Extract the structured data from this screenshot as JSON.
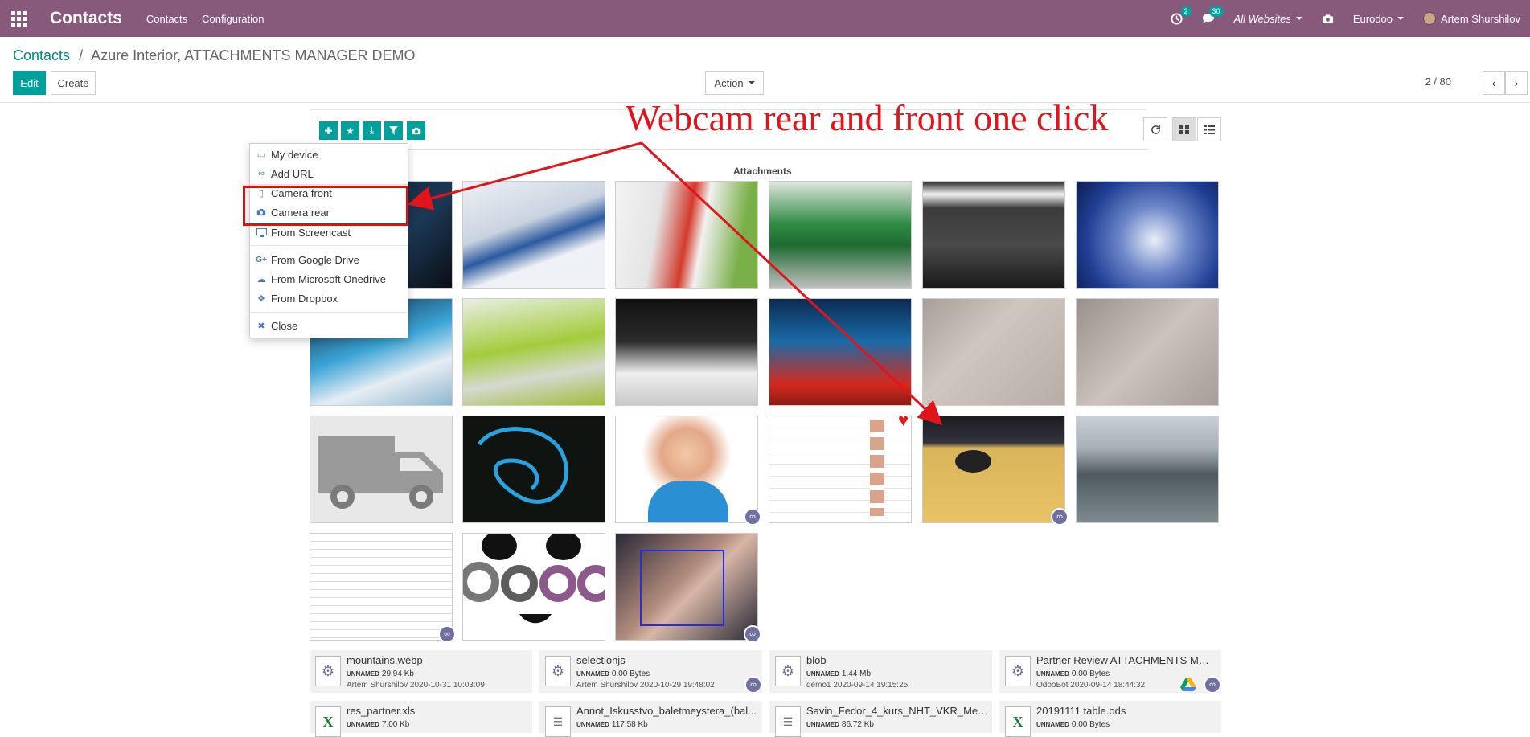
{
  "navbar": {
    "app_title": "Contacts",
    "menu": [
      "Contacts",
      "Configuration"
    ],
    "activity_count": "2",
    "message_count": "30",
    "website": "All Websites",
    "company": "Eurodoo",
    "user": "Artem Shurshilov"
  },
  "breadcrumb": {
    "root": "Contacts",
    "separator": "/",
    "current": "Azure Interior, ATTACHMENTS MANAGER DEMO"
  },
  "buttons": {
    "edit": "Edit",
    "create": "Create",
    "action": "Action"
  },
  "pager": {
    "value": "2 / 80",
    "prev": "‹",
    "next": "›"
  },
  "attachments": {
    "label": "Attachments"
  },
  "upload_menu": {
    "items": [
      {
        "label": "My device",
        "icon": "folder-open-icon"
      },
      {
        "label": "Add URL",
        "icon": "link-icon"
      },
      {
        "label": "Camera front",
        "icon": "mobile-icon"
      },
      {
        "label": "Camera rear",
        "icon": "camera-icon"
      },
      {
        "label": "From Screencast",
        "icon": "desktop-icon"
      },
      {
        "label": "From Google Drive",
        "icon": "google-plus-icon"
      },
      {
        "label": "From Microsoft Onedrive",
        "icon": "cloud-icon"
      },
      {
        "label": "From Dropbox",
        "icon": "dropbox-icon"
      },
      {
        "label": "Close",
        "icon": "close-icon"
      }
    ]
  },
  "annotation": {
    "text": "Webcam rear and front one click",
    "color": "#e0141a"
  },
  "files": [
    {
      "name": "mountains.webp",
      "tag": "UNNAMED",
      "size": "29.94 Kb",
      "user": "Artem Shurshilov 2020-10-31 10:03:09",
      "icon": "gear-icon"
    },
    {
      "name": "selectionjs",
      "tag": "UNNAMED",
      "size": "0.00 Bytes",
      "user": "Artem Shurshilov 2020-10-29 19:48:02",
      "icon": "gear-icon"
    },
    {
      "name": "blob",
      "tag": "UNNAMED",
      "size": "1.44 Mb",
      "user": "demo1 2020-09-14 19:15:25",
      "icon": "gear-icon"
    },
    {
      "name": "Partner Review ATTACHMENTS MAN...",
      "tag": "UNNAMED",
      "size": "0.00 Bytes",
      "user": "OdooBot 2020-09-14 18:44:32",
      "icon": "gear-icon"
    },
    {
      "name": "res_partner.xls",
      "tag": "UNNAMED",
      "size": "7.00 Kb",
      "user": "",
      "icon": "excel-icon"
    },
    {
      "name": "Annot_Iskusstvo_baletmeystera_(bal...",
      "tag": "UNNAMED",
      "size": "117.58 Kb",
      "user": "",
      "icon": "document-icon"
    },
    {
      "name": "Savin_Fedor_4_kurs_NHT_VKR_Meto...",
      "tag": "UNNAMED",
      "size": "86.72 Kb",
      "user": "",
      "icon": "document-icon"
    },
    {
      "name": "20191111 table.ods",
      "tag": "UNNAMED",
      "size": "0.00 Bytes",
      "user": "",
      "icon": "excel-icon"
    }
  ],
  "colors": {
    "navbar": "#875a7b",
    "primary": "#00a09d",
    "annotation": "#e0141a"
  }
}
